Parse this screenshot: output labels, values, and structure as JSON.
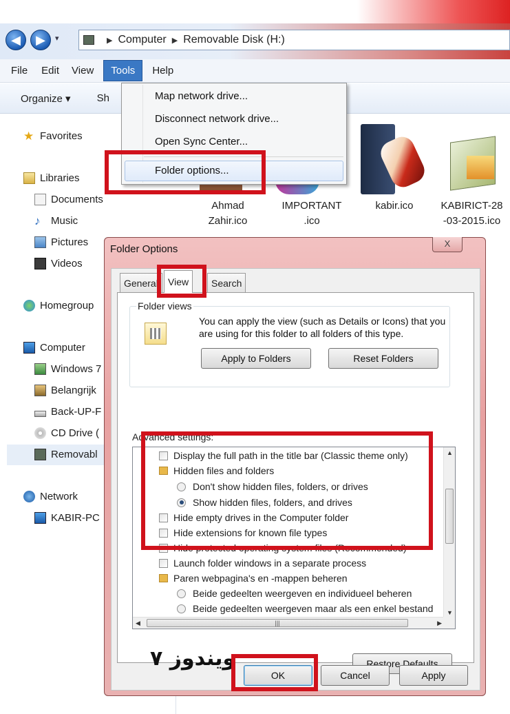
{
  "explorer": {
    "address": {
      "computer": "Computer",
      "drive": "Removable Disk (H:)"
    },
    "menu": [
      "File",
      "Edit",
      "View",
      "Tools",
      "Help"
    ],
    "commands": {
      "organize": "Organize ▾",
      "share_partial": "Sh"
    },
    "sidebar": {
      "favorites": "Favorites",
      "libraries": "Libraries",
      "documents": "Documents",
      "music": "Music",
      "pictures": "Pictures",
      "videos": "Videos",
      "homegroup": "Homegroup",
      "computer": "Computer",
      "windows": "Windows 7",
      "belangrijk": "Belangrijk",
      "backup": "Back-UP-F",
      "cddrive": "CD Drive (",
      "removable": "Removabl",
      "network": "Network",
      "kabirpc": "KABIR-PC"
    },
    "files": [
      {
        "line1": "Ahmad",
        "line2": "Zahir.ico"
      },
      {
        "line1": "IMPORTANT",
        "line2": ".ico"
      },
      {
        "line1": "kabir.ico",
        "line2": ""
      },
      {
        "line1": "KABIRICT-28",
        "line2": "-03-2015.ico"
      }
    ]
  },
  "tools_menu": {
    "items": [
      "Map network drive...",
      "Disconnect network drive...",
      "Open Sync Center...",
      "Folder options..."
    ],
    "highlighted": "Folder options..."
  },
  "dialog": {
    "title": "Folder Options",
    "close_glyph": "X",
    "tabs": [
      "General",
      "View",
      "Search"
    ],
    "active_tab": "View",
    "folder_views": {
      "label": "Folder views",
      "description": "You can apply the view (such as Details or Icons) that you are using for this folder to all folders of this type.",
      "apply_button": "Apply to Folders",
      "reset_button": "Reset Folders"
    },
    "advanced_label": "Advanced settings:",
    "settings": [
      {
        "type": "checkbox",
        "text": "Display the full path in the title bar (Classic theme only)",
        "checked": false
      },
      {
        "type": "folder",
        "text": "Hidden files and folders"
      },
      {
        "type": "radio",
        "text": "Don't show hidden files, folders, or drives",
        "checked": false
      },
      {
        "type": "radio",
        "text": "Show hidden files, folders, and drives",
        "checked": true
      },
      {
        "type": "checkbox",
        "text": "Hide empty drives in the Computer folder",
        "checked": false
      },
      {
        "type": "checkbox",
        "text": "Hide extensions for known file types",
        "checked": false
      },
      {
        "type": "checkbox",
        "text": "Hide protected operating system files (Recommended)",
        "checked": false
      },
      {
        "type": "checkbox",
        "text": "Launch folder windows in a separate process",
        "checked": false
      },
      {
        "type": "folder",
        "text": "Paren webpagina's en -mappen beheren"
      },
      {
        "type": "radio",
        "text": "Beide gedeelten weergeven en individueel beheren",
        "checked": false
      },
      {
        "type": "radio",
        "text": "Beide gedeelten weergeven maar als een enkel bestand",
        "checked": false
      }
    ],
    "restore_defaults": "Restore Defaults",
    "watermark": "ویندوز ۷",
    "ok": "OK",
    "cancel": "Cancel",
    "apply": "Apply"
  },
  "highlight_color": "#d0121c"
}
